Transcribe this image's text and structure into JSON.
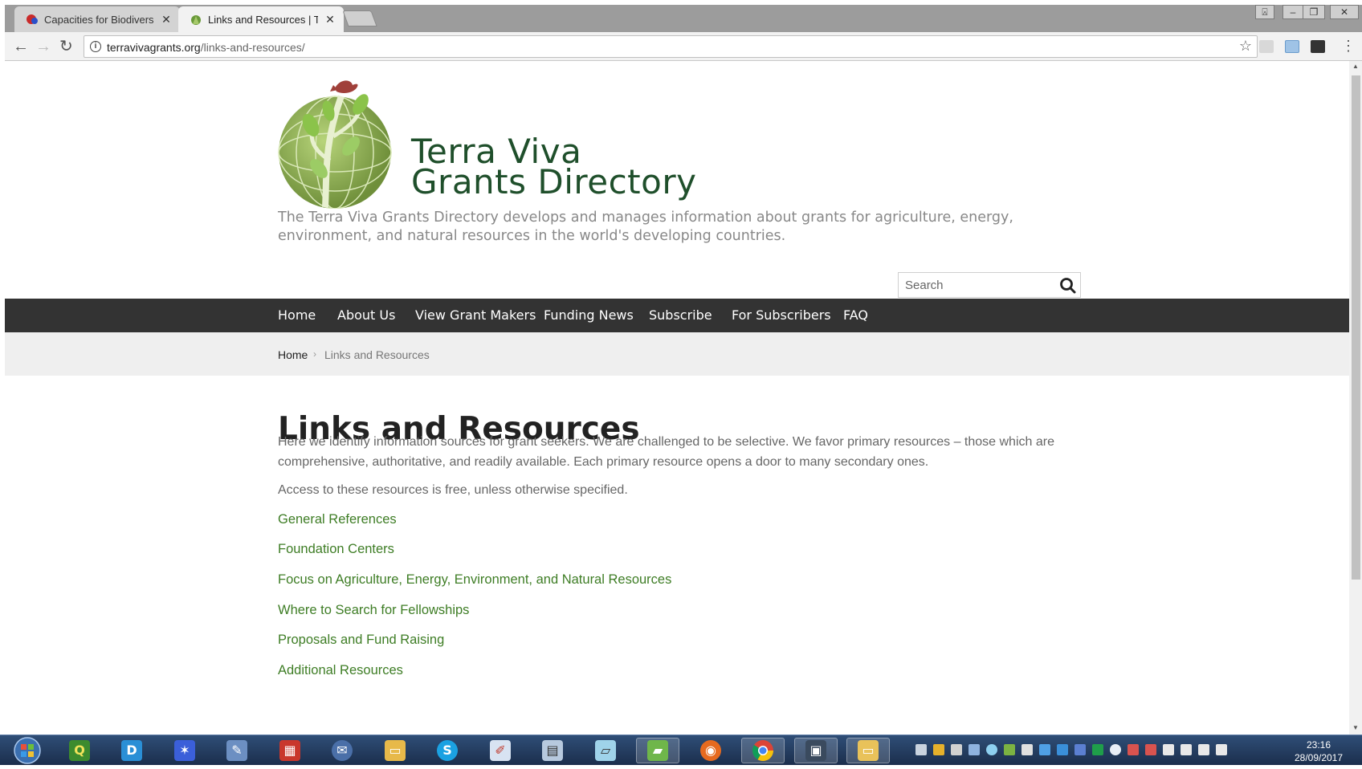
{
  "browser": {
    "tabs": [
      {
        "title": "Capacities for Biodiversit",
        "active": false,
        "favicon": "red-blue-icon"
      },
      {
        "title": "Links and Resources | Te",
        "active": true,
        "favicon": "terra-viva-leaf-icon"
      }
    ],
    "url_host": "terravivagrants.org",
    "url_path": "/links-and-resources/"
  },
  "site": {
    "title_line1": "Terra Viva",
    "title_line2": "Grants Directory",
    "tagline": "The Terra Viva Grants Directory develops and manages information about grants for agriculture, energy, environment, and natural resources in the world's developing countries.",
    "search_placeholder": "Search"
  },
  "nav": {
    "items": [
      "Home",
      "About Us",
      "View Grant Makers",
      "Funding News",
      "Subscribe",
      "For Subscribers",
      "FAQ"
    ]
  },
  "breadcrumb": {
    "home": "Home",
    "separator": "›",
    "current": "Links and Resources"
  },
  "main": {
    "title": "Links and Resources",
    "intro": "Here we identify information sources for grant seekers.  We are challenged to be selective. We favor primary resources – those which are comprehensive, authoritative, and readily available. Each primary resource opens a door to many secondary ones.",
    "access_note": "Access to these resources is free, unless otherwise specified.",
    "links": [
      "General References",
      "Foundation Centers",
      "Focus on Agriculture, Energy, Environment, and Natural Resources",
      "Where to Search for Fellowships",
      "Proposals and Fund Raising",
      "Additional Resources"
    ]
  },
  "taskbar": {
    "apps": [
      "qgis-icon",
      "dictionary-icon",
      "network-graph-icon",
      "pencil-tools-icon",
      "office-apps-icon",
      "thunderbird-icon",
      "folder-icon",
      "skype-icon",
      "paint-icon",
      "calculator-icon",
      "notepad-icon",
      "sticky-note-icon",
      "firefox-icon",
      "chrome-icon",
      "monitor-icon",
      "explorer-icon"
    ],
    "time": "23:16",
    "date": "28/09/2017"
  },
  "colors": {
    "brand_green": "#1f4f2b",
    "link_green": "#3e7d25",
    "navbar": "#333333"
  }
}
